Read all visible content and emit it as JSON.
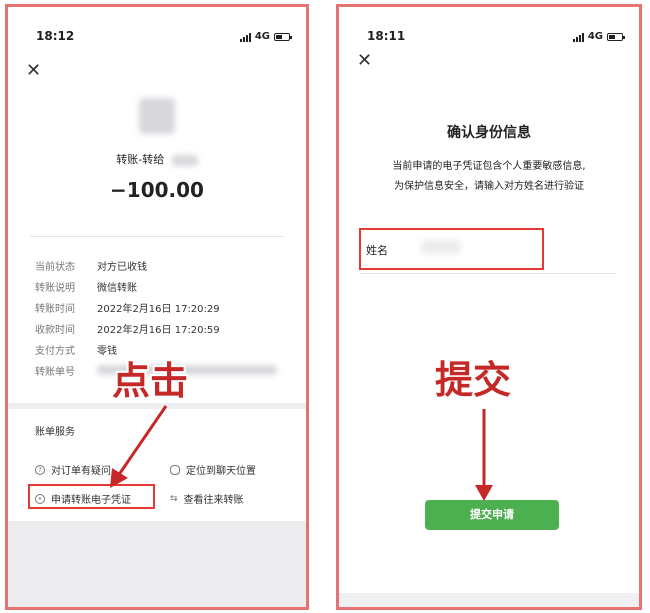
{
  "left": {
    "status": {
      "time": "18:12",
      "network": "4G"
    },
    "transfer_title": "转账-转给",
    "amount": "−100.00",
    "details": [
      {
        "label": "当前状态",
        "value": "对方已收钱"
      },
      {
        "label": "转账说明",
        "value": "微信转账"
      },
      {
        "label": "转账时间",
        "value": "2022年2月16日 17:20:29"
      },
      {
        "label": "收款时间",
        "value": "2022年2月16日 17:20:59"
      },
      {
        "label": "支付方式",
        "value": "零钱"
      },
      {
        "label": "转账单号",
        "value": ""
      }
    ],
    "service_title": "账单服务",
    "services": {
      "dispute": "对订单有疑问",
      "locate": "定位到聊天位置",
      "voucher": "申请转账电子凭证",
      "history": "查看往来转账"
    },
    "callout": "点击"
  },
  "right": {
    "status": {
      "time": "18:11",
      "network": "4G"
    },
    "title": "确认身份信息",
    "desc_line1": "当前申请的电子凭证包含个人重要敏感信息,",
    "desc_line2": "为保护信息安全，请输入对方姓名进行验证",
    "name_label": "姓名",
    "callout": "提交",
    "submit_label": "提交申请"
  },
  "colors": {
    "highlight": "#e53935",
    "callout": "#c62828",
    "submit": "#4caf50"
  }
}
